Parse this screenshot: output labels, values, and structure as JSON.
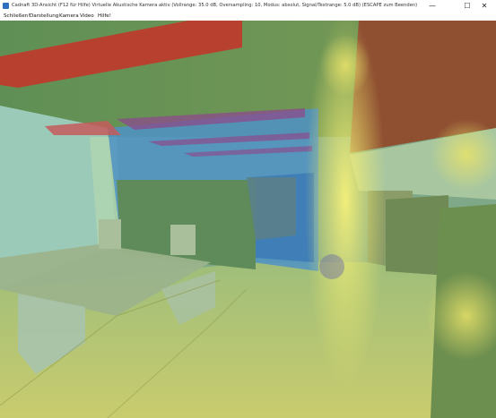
{
  "window": {
    "title": "Cadnaft 3D-Ansicht (F12 für Hilfe) Virtuelle Akustische Kamera aktiv (Vollrange: 35.0 dB, Oversampling: 10, Modus: absolut, Signal/Textrange: 5.0 dB) (ESCAPE zum Beenden)",
    "minimize_glyph": "—",
    "maximize_glyph": "☐",
    "close_glyph": "✕"
  },
  "menu": {
    "items": [
      "Schließen!",
      "Darstellung",
      "Kamera",
      "Video",
      "Hilfe!"
    ]
  },
  "viewport": {
    "description_colors": {
      "floor": "#b9c873",
      "left_wall": "#9ccab9",
      "back_blue": "#4f92c6",
      "ceiling_red": "#b8402e",
      "right_ceiling_brown": "#8f5032",
      "yellow_hotspot": "#f0ea6a"
    }
  }
}
